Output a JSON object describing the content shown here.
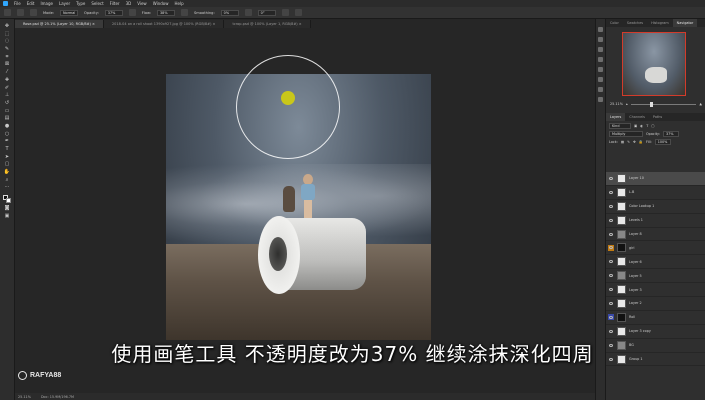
{
  "menu": [
    "File",
    "Edit",
    "Image",
    "Layer",
    "Type",
    "Select",
    "Filter",
    "3D",
    "View",
    "Window",
    "Help"
  ],
  "options": {
    "mode_label": "Mode:",
    "mode_value": "Normal",
    "opacity_label": "Opacity:",
    "opacity_value": "37%",
    "flow_label": "Flow:",
    "flow_value": "38%",
    "smoothing_label": "Smoothing:",
    "smoothing_value": "0%",
    "angle_value": "0°"
  },
  "tabs": [
    {
      "label": "Rose.psd @ 25.1% (Layer 10, RGB/8#) ×",
      "active": true
    },
    {
      "label": "2018-04 on a roll shoot 1390x927.jpg @ 100% (RGB/8#) ×",
      "active": false
    },
    {
      "label": "tcrop.psd @ 100% (Layer 1, RGB/8#) ×",
      "active": false
    }
  ],
  "subtitle": "使用画笔工具 不透明度改为37% 继续涂抹深化四周",
  "watermark": "RAFYA88",
  "status": {
    "zoom": "25.11%",
    "doc": "Doc: 15.9M/196.7M"
  },
  "panel_tabs_top": [
    "Color",
    "Swatches",
    "Histogram",
    "Navigator"
  ],
  "navigator": {
    "zoom": "25.11%"
  },
  "panel_tabs_layers": [
    "Layers",
    "Channels",
    "Paths"
  ],
  "layer_controls": {
    "kind": "Kind",
    "blend": "Multiply",
    "opacity_label": "Opacity:",
    "opacity": "37%",
    "lock_label": "Lock:",
    "fill_label": "Fill:",
    "fill": "100%"
  },
  "layers": [
    {
      "name": "Layer 10",
      "thumb": "light",
      "selected": true,
      "eye": ""
    },
    {
      "name": "L.B",
      "thumb": "light",
      "selected": false,
      "eye": ""
    },
    {
      "name": "Color Lookup 1",
      "thumb": "light",
      "selected": false,
      "eye": ""
    },
    {
      "name": "Levels 1",
      "thumb": "light",
      "selected": false,
      "eye": ""
    },
    {
      "name": "Layer 8",
      "thumb": "gray",
      "selected": false,
      "eye": ""
    },
    {
      "name": "girl",
      "thumb": "dark",
      "selected": false,
      "eye": "orange"
    },
    {
      "name": "Layer 6",
      "thumb": "light",
      "selected": false,
      "eye": ""
    },
    {
      "name": "Layer 5",
      "thumb": "gray",
      "selected": false,
      "eye": ""
    },
    {
      "name": "Layer 3",
      "thumb": "light",
      "selected": false,
      "eye": ""
    },
    {
      "name": "Layer 2",
      "thumb": "light",
      "selected": false,
      "eye": ""
    },
    {
      "name": "Roll",
      "thumb": "dark",
      "selected": false,
      "eye": "blue"
    },
    {
      "name": "Layer 3 copy",
      "thumb": "light",
      "selected": false,
      "eye": ""
    },
    {
      "name": "BG",
      "thumb": "gray",
      "selected": false,
      "eye": ""
    },
    {
      "name": "Group 1",
      "thumb": "light",
      "selected": false,
      "eye": ""
    }
  ]
}
